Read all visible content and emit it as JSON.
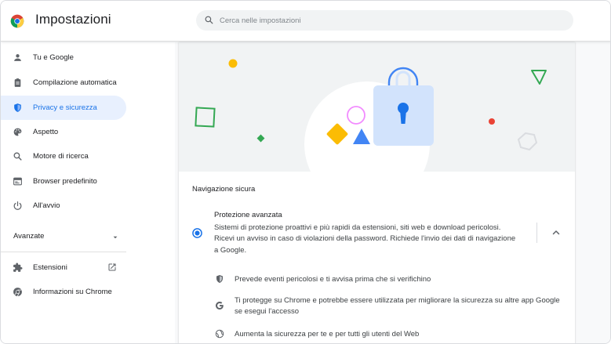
{
  "header": {
    "app_title": "Impostazioni",
    "search_placeholder": "Cerca nelle impostazioni"
  },
  "sidebar": {
    "items": [
      {
        "label": "Tu e Google",
        "icon": "person-icon"
      },
      {
        "label": "Compilazione automatica",
        "icon": "clipboard-icon"
      },
      {
        "label": "Privacy e sicurezza",
        "icon": "shield-icon",
        "active": true
      },
      {
        "label": "Aspetto",
        "icon": "palette-icon"
      },
      {
        "label": "Motore di ricerca",
        "icon": "search-icon"
      },
      {
        "label": "Browser predefinito",
        "icon": "browser-icon"
      },
      {
        "label": "All'avvio",
        "icon": "power-icon"
      }
    ],
    "advanced_label": "Avanzate",
    "bottom_items": [
      {
        "label": "Estensioni",
        "icon": "puzzle-icon"
      },
      {
        "label": "Informazioni su Chrome",
        "icon": "chrome-icon"
      }
    ]
  },
  "main": {
    "section_title": "Navigazione sicura",
    "option": {
      "title": "Protezione avanzata",
      "description": "Sistemi di protezione proattivi e più rapidi da estensioni, siti web e download pericolosi. Ricevi un avviso in caso di violazioni della password. Richiede l'invio dei dati di navigazione a Google.",
      "selected": true
    },
    "features": [
      {
        "icon": "shield-icon",
        "text": "Prevede eventi pericolosi e ti avvisa prima che si verifichino"
      },
      {
        "icon": "google-g-icon",
        "text": "Ti protegge su Chrome e potrebbe essere utilizzata per migliorare la sicurezza su altre app Google se esegui l'accesso"
      },
      {
        "icon": "globe-icon",
        "text": "Aumenta la sicurezza per te e per tutti gli utenti del Web"
      }
    ]
  },
  "colors": {
    "accent": "#1a73e8",
    "active_bg": "#e8f0fe",
    "icon_grey": "#5f6368"
  }
}
